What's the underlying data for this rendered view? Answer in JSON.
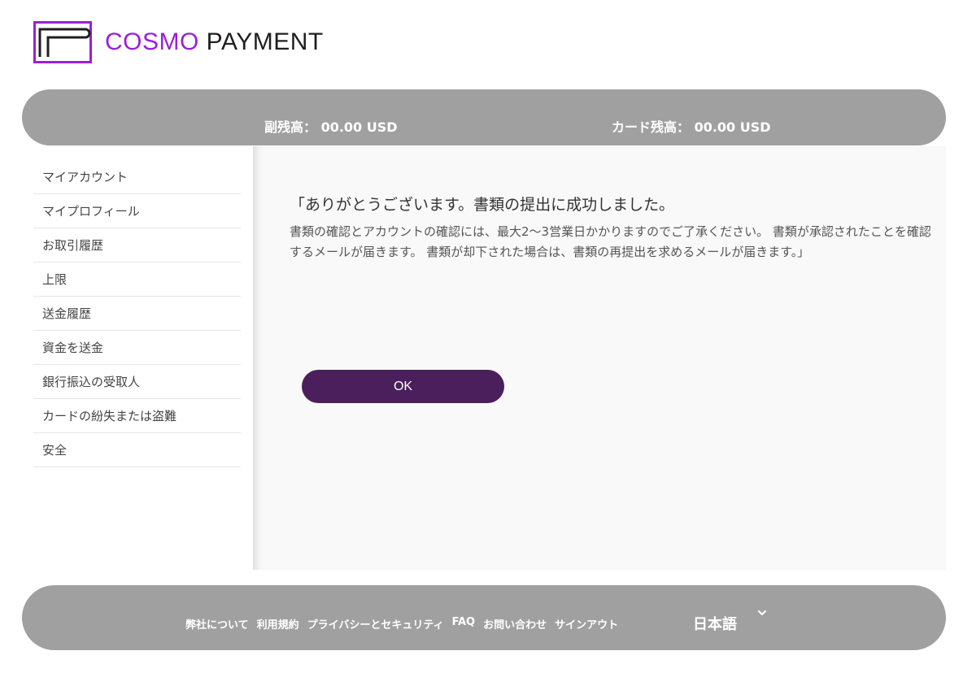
{
  "logo": {
    "text_primary": "COSMO",
    "text_secondary": " PAYMENT",
    "icon": "cosmo-logo-mark"
  },
  "balances": {
    "sub_balance": "副残高： 00.00 USD",
    "card_balance": "カード残高： 00.00 USD"
  },
  "sidebar": {
    "items": [
      {
        "label": "マイアカウント"
      },
      {
        "label": "マイプロフィール"
      },
      {
        "label": "お取引履歴"
      },
      {
        "label": "上限"
      },
      {
        "label": "送金履歴"
      },
      {
        "label": "資金を送金"
      },
      {
        "label": "銀行振込の受取人"
      },
      {
        "label": "カードの紛失または盗難"
      },
      {
        "label": "安全"
      }
    ]
  },
  "main": {
    "title": "「ありがとうございます。書類の提出に成功しました。",
    "body": "書類の確認とアカウントの確認には、最大2〜3営業日かかりますのでご了承ください。 書類が承認されたことを確認するメールが届きます。 書類が却下された場合は、書類の再提出を求めるメールが届きます。」",
    "ok_label": "OK"
  },
  "footer": {
    "links": [
      {
        "label": "弊社について"
      },
      {
        "label": "利用規約"
      },
      {
        "label": "プライバシーとセキュリティ"
      },
      {
        "label": "FAQ"
      },
      {
        "label": "お問い合わせ"
      },
      {
        "label": "サインアウト"
      }
    ],
    "language": "日本語"
  },
  "colors": {
    "brand_purple": "#9b1fd8",
    "button_purple": "#4b1f5c",
    "bar_gray": "#a0a0a0"
  }
}
